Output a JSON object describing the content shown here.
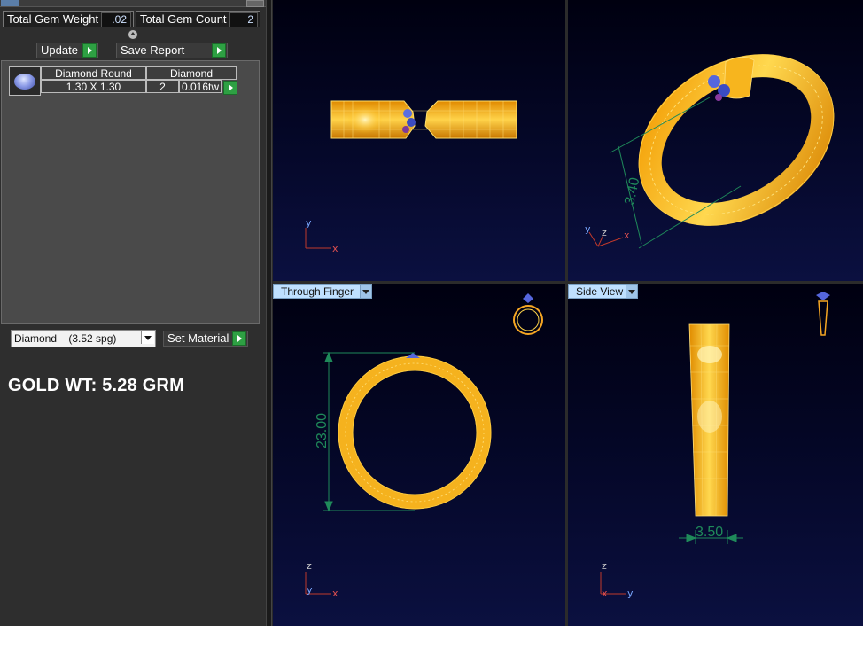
{
  "panel": {
    "total_gem_weight_label": "Total Gem Weight",
    "total_gem_weight_value": ".02",
    "total_gem_count_label": "Total Gem Count",
    "total_gem_count_value": "2",
    "update_label": "Update",
    "save_report_label": "Save Report",
    "gem_table": {
      "header": [
        "Diamond Round",
        "Diamond"
      ],
      "row": {
        "size": "1.30 X 1.30",
        "count": "2",
        "weight": "0.016tw"
      }
    },
    "material_select": "Diamond    (3.52 spg)",
    "set_material_label": "Set Material",
    "gold_weight": "GOLD WT: 5.28 GRM"
  },
  "viewports": {
    "through_finger_label": "Through Finger",
    "side_view_label": "Side View",
    "dim_height": "23.00",
    "dim_width": "3.50",
    "dim_diag": "3.40"
  },
  "axes": {
    "front_v": "y",
    "front_h": "x",
    "persp_1": "y",
    "persp_2": "z",
    "persp_3": "x",
    "through_v": "z",
    "through_c": "y",
    "through_h": "x",
    "side_v": "z",
    "side_c": "x",
    "side_h": "y"
  },
  "colors": {
    "gold": "#f5a623",
    "wire": "#ffd54a",
    "dimension": "#1f8a5a",
    "gem": "#5a6ee0",
    "viewport_bg": "#05082a"
  }
}
